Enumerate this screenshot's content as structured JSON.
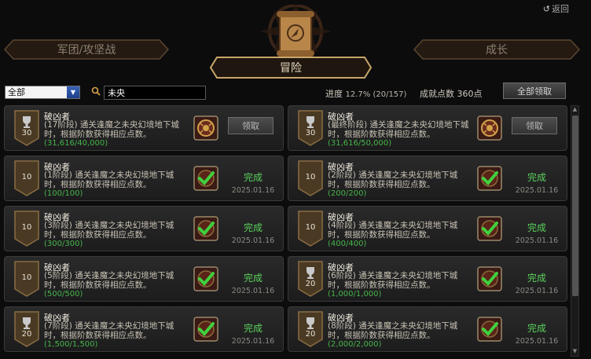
{
  "header": {
    "back_label": "返回",
    "tab_left": "军团/攻坚战",
    "tab_center": "冒险",
    "tab_right": "成长"
  },
  "toolbar": {
    "filter_value": "全部",
    "search_value": "未央",
    "progress_label": "进度",
    "progress_value": "12.7% (20/157)",
    "points_label": "成就点数",
    "points_value": "360点",
    "claim_all_label": "全部领取"
  },
  "cards": [
    {
      "title": "破凶者",
      "desc": "(17阶段) 通关逢魔之未央幻境地下城时，根据阶数获得相应点数。",
      "progress": "(31,616/40,000)",
      "points": "30",
      "state": "claim",
      "action": "领取"
    },
    {
      "title": "破凶者",
      "desc": "(最终阶段) 通关逢魔之未央幻境地下城时，根据阶数获得相应点数。",
      "progress": "(31,616/50,000)",
      "points": "30",
      "state": "claim",
      "action": "领取"
    },
    {
      "title": "破凶者",
      "desc": "(1阶段) 通关逢魔之未央幻境地下城时，根据阶数获得相应点数。",
      "progress": "(100/100)",
      "points": "10",
      "state": "done",
      "action": "完成",
      "date": "2025.01.16"
    },
    {
      "title": "破凶者",
      "desc": "(2阶段) 通关逢魔之未央幻境地下城时，根据阶数获得相应点数。",
      "progress": "(200/200)",
      "points": "10",
      "state": "done",
      "action": "完成",
      "date": "2025.01.16"
    },
    {
      "title": "破凶者",
      "desc": "(3阶段) 通关逢魔之未央幻境地下城时，根据阶数获得相应点数。",
      "progress": "(300/300)",
      "points": "10",
      "state": "done",
      "action": "完成",
      "date": "2025.01.16"
    },
    {
      "title": "破凶者",
      "desc": "(4阶段) 通关逢魔之未央幻境地下城时，根据阶数获得相应点数。",
      "progress": "(400/400)",
      "points": "10",
      "state": "done",
      "action": "完成",
      "date": "2025.01.16"
    },
    {
      "title": "破凶者",
      "desc": "(5阶段) 通关逢魔之未央幻境地下城时，根据阶数获得相应点数。",
      "progress": "(500/500)",
      "points": "10",
      "state": "done",
      "action": "完成",
      "date": "2025.01.16"
    },
    {
      "title": "破凶者",
      "desc": "(6阶段) 通关逢魔之未央幻境地下城时，根据阶数获得相应点数。",
      "progress": "(1,000/1,000)",
      "points": "20",
      "state": "done",
      "action": "完成",
      "date": "2025.01.16"
    },
    {
      "title": "破凶者",
      "desc": "(7阶段) 通关逢魔之未央幻境地下城时，根据阶数获得相应点数。",
      "progress": "(1,500/1,500)",
      "points": "20",
      "state": "done",
      "action": "完成",
      "date": "2025.01.16"
    },
    {
      "title": "破凶者",
      "desc": "(8阶段) 通关逢魔之未央幻境地下城时，根据阶数获得相应点数。",
      "progress": "(2,000/2,000)",
      "points": "20",
      "state": "done",
      "action": "完成",
      "date": "2025.01.16"
    }
  ],
  "colors": {
    "accent_gold": "#8a6a3a",
    "complete_green": "#5bd25b",
    "progress_green": "#47b54a"
  }
}
